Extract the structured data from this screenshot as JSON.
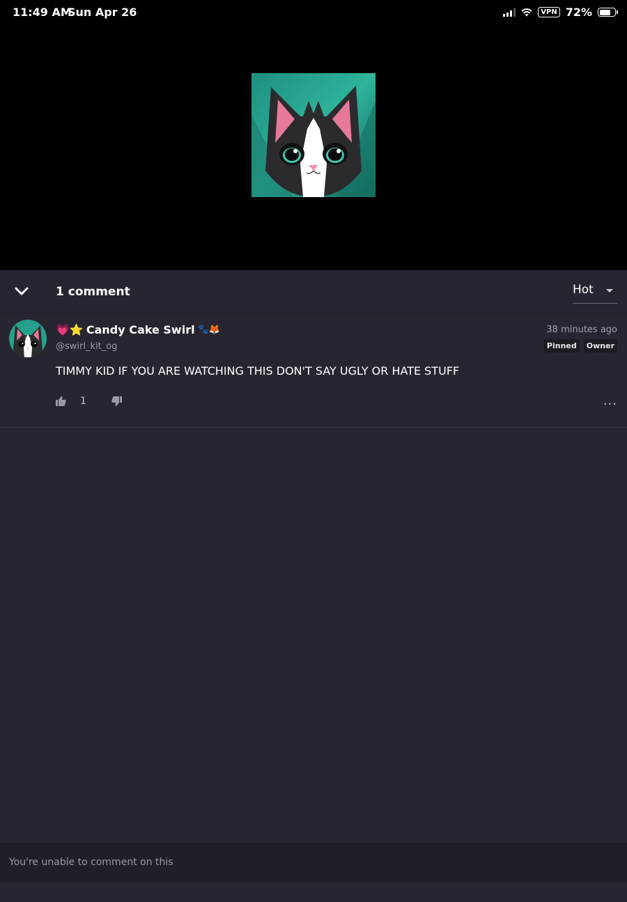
{
  "status_bar": {
    "time": "11:49 AM",
    "date": "Sun Apr 26",
    "vpn": "VPN",
    "battery": "72%"
  },
  "media": {
    "cover_icon": "cat-avatar-image"
  },
  "comments_header": {
    "count_label": "1 comment",
    "sort_label": "Hot"
  },
  "comment": {
    "author_prefix_emoji": "💗⭐",
    "author": "Candy Cake Swirl",
    "author_suffix_emoji": "🐾🦊",
    "handle": "@swirl_kit_og",
    "time": "38 minutes ago",
    "badges": [
      "Pinned",
      "Owner"
    ],
    "body": "TIMMY KID IF YOU ARE WATCHING THIS DON'T SAY UGLY OR HATE STUFF",
    "likes": "1",
    "more": "..."
  },
  "composer": {
    "notice": "You're unable to comment on this"
  }
}
